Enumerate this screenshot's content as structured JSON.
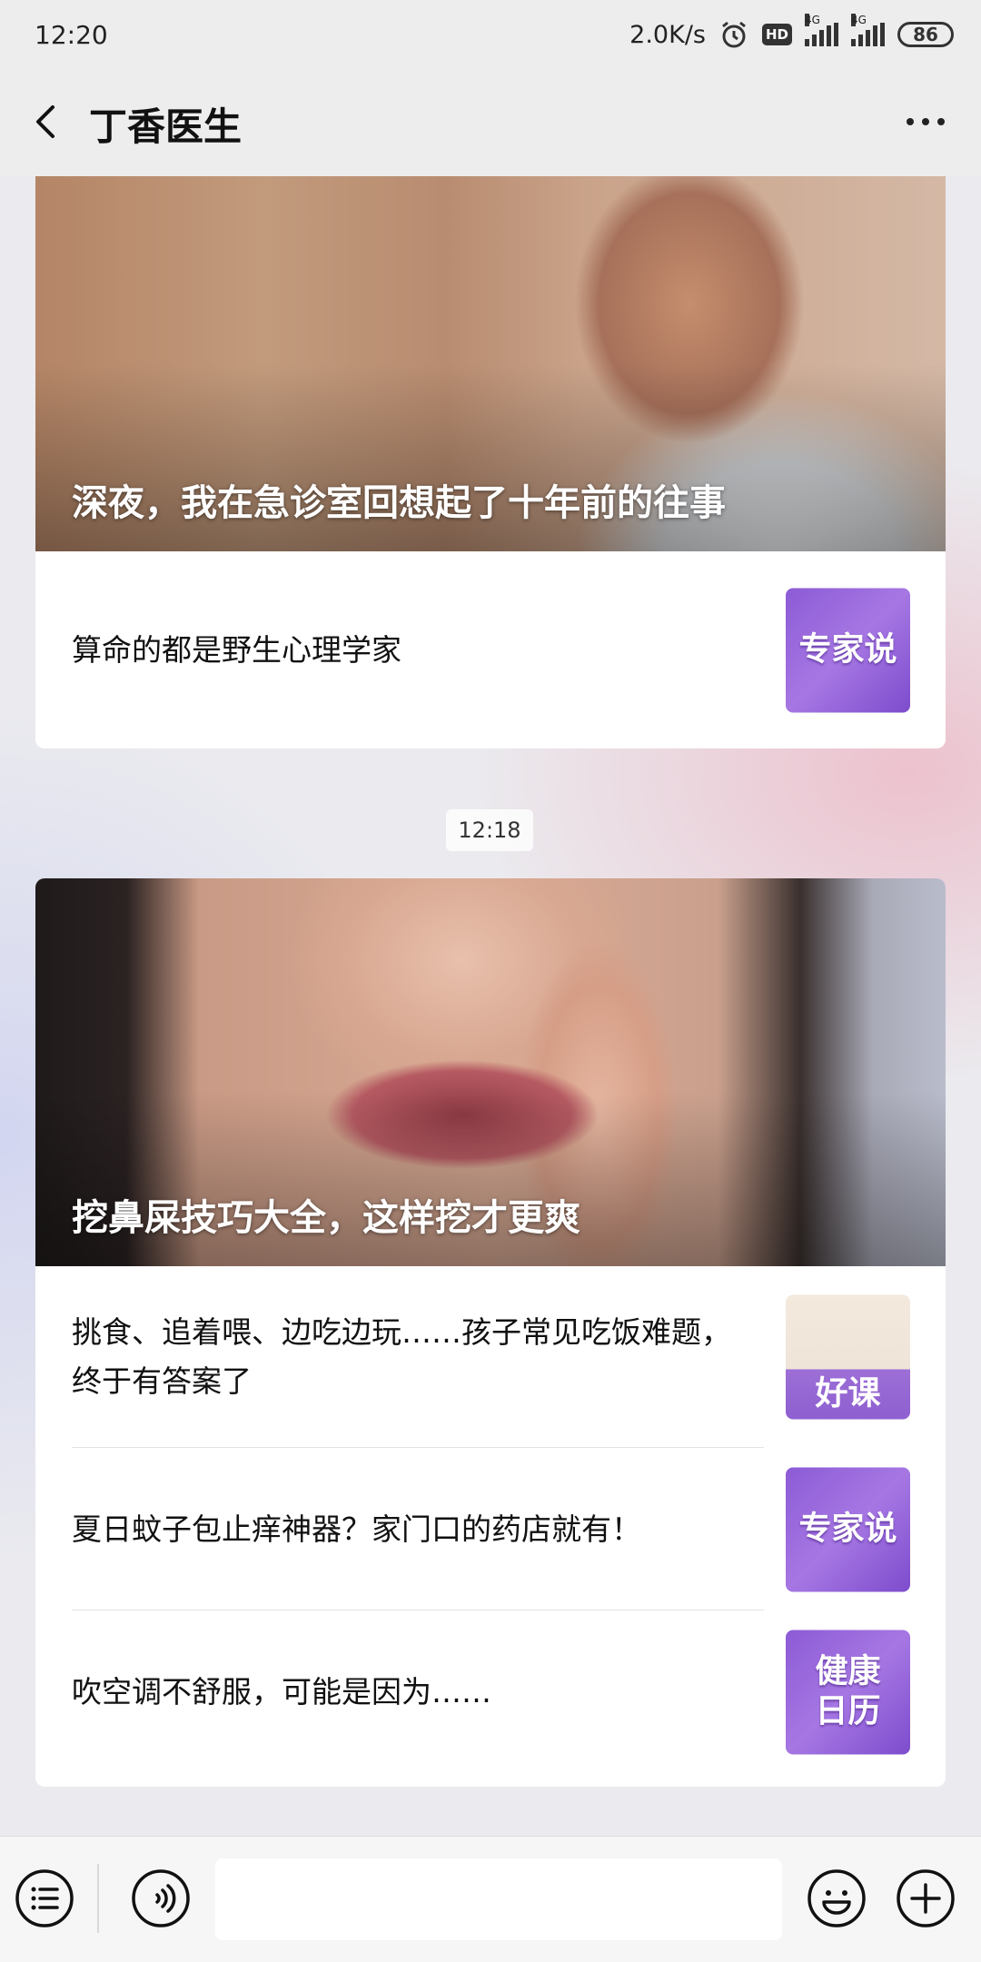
{
  "status_bar": {
    "time": "12:20",
    "net_speed": "2.0K/s",
    "net_type_1": "4G",
    "net_type_2": "4G",
    "hd": "HD",
    "battery": "86"
  },
  "header": {
    "title": "丁香医生"
  },
  "card1": {
    "hero_title": "深夜，我在急诊室回想起了十年前的往事",
    "items": [
      {
        "text": "算命的都是野生心理学家",
        "thumb_label": "专家说"
      }
    ]
  },
  "timestamp": "12:18",
  "card2": {
    "hero_title": "挖鼻屎技巧大全，这样挖才更爽",
    "items": [
      {
        "text": "挑食、追着喂、边吃边玩……孩子常见吃饭难题，终于有答案了",
        "thumb_label": "好课"
      },
      {
        "text": "夏日蚊子包止痒神器？家门口的药店就有！",
        "thumb_label": "专家说"
      },
      {
        "text": "吹空调不舒服，可能是因为……",
        "thumb_label": "健康日历"
      }
    ]
  },
  "bottom_bar": {
    "input_value": ""
  },
  "icons": [
    "back-icon",
    "more-icon",
    "alarm-icon",
    "signal-icon",
    "battery-icon",
    "menu-list-icon",
    "voice-icon",
    "emoji-icon",
    "plus-icon"
  ],
  "colors": {
    "accent_purple": "#8c5bd6",
    "bar_bg": "#ededed"
  }
}
